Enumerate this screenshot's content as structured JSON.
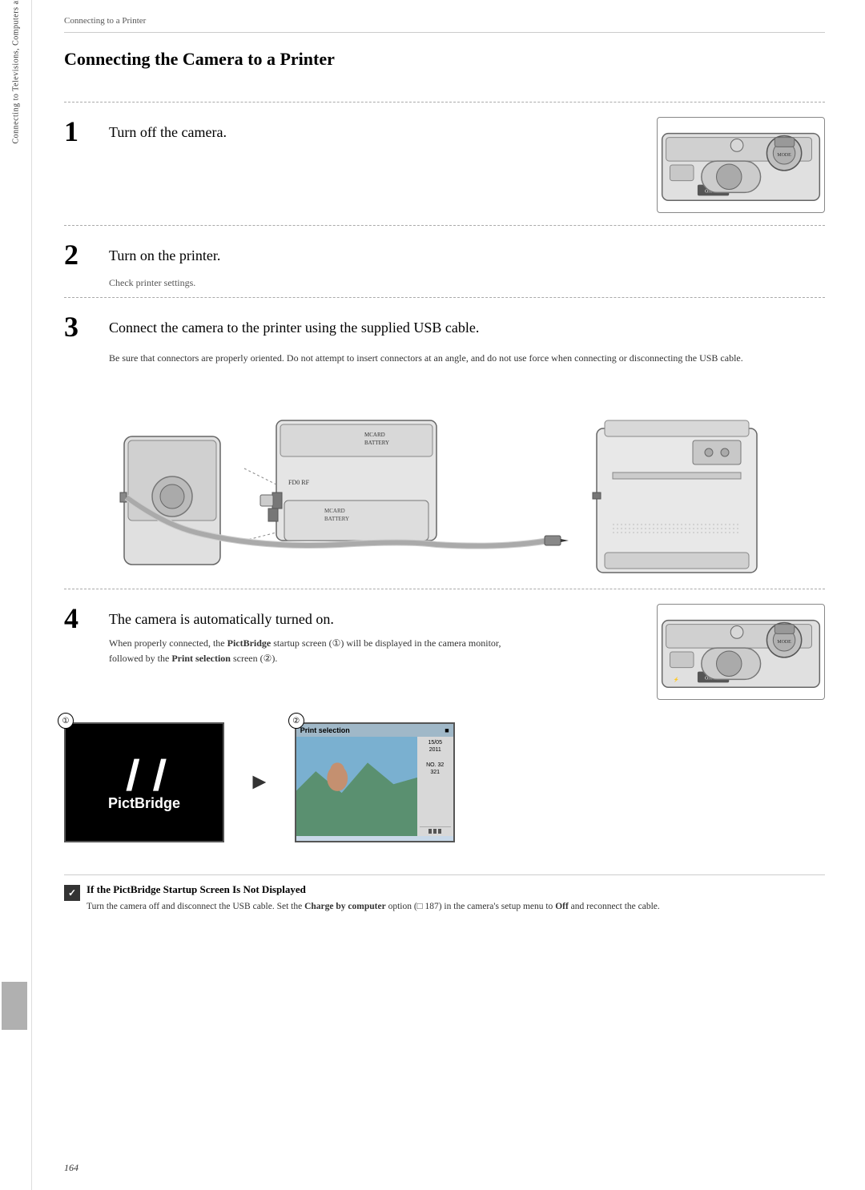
{
  "breadcrumb": "Connecting to a Printer",
  "page_title": "Connecting the Camera to a Printer",
  "steps": [
    {
      "number": "1",
      "title": "Turn off the camera.",
      "subtitle": "",
      "description": ""
    },
    {
      "number": "2",
      "title": "Turn on the printer.",
      "subtitle": "Check printer settings.",
      "description": ""
    },
    {
      "number": "3",
      "title": "Connect the camera to the printer using the supplied USB cable.",
      "subtitle": "",
      "description": "Be sure that connectors are properly oriented. Do not attempt to insert connectors at an angle, and do not use force when connecting or disconnecting the USB cable."
    },
    {
      "number": "4",
      "title": "The camera is automatically turned on.",
      "subtitle": "",
      "description_parts": [
        "When properly connected, the ",
        "PictBridge",
        " startup screen (①) will be displayed in the camera monitor, followed by the ",
        "Print selection",
        " screen (②)."
      ]
    }
  ],
  "screen1_label": "①",
  "screen2_label": "②",
  "pictbridge_text": "PictBridge",
  "print_selection_title": "Print selection",
  "print_date_1": "15/05",
  "print_date_2": "2011",
  "print_no_label": "NO. 32",
  "print_no_value": "321",
  "note": {
    "title": "If the PictBridge Startup Screen Is Not Displayed",
    "text": "Turn the camera off and disconnect the USB cable. Set the Charge by computer option (□ 187) in the camera's setup menu to Off and reconnect the cable."
  },
  "page_number": "164",
  "sidebar_top_text": "Connecting to Televisions, Computers and Printers"
}
